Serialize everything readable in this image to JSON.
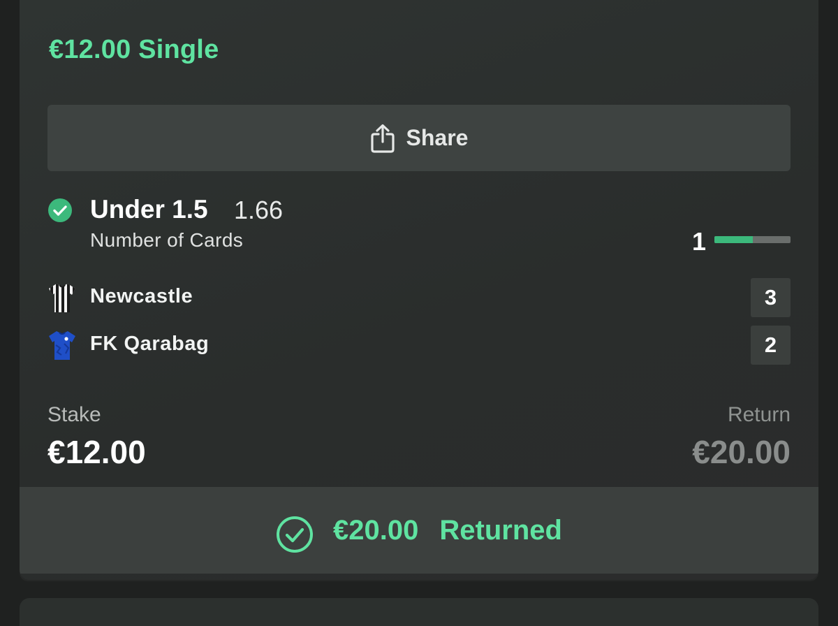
{
  "bet": {
    "title": "€12.00 Single",
    "share_label": "Share",
    "selection": {
      "name": "Under 1.5",
      "odds": "1.66",
      "market": "Number of Cards",
      "status_icon": "check-circle-icon",
      "progress_value": "1",
      "progress_fraction": 0.5
    },
    "teams": [
      {
        "name": "Newcastle",
        "score": "3",
        "shirt_icon": "newcastle-shirt-icon"
      },
      {
        "name": "FK Qarabag",
        "score": "2",
        "shirt_icon": "qarabag-shirt-icon"
      }
    ],
    "stake_label": "Stake",
    "stake_value": "€12.00",
    "return_label": "Return",
    "return_value": "€20.00",
    "returned_amount": "€20.00",
    "returned_label": "Returned"
  },
  "colors": {
    "accent": "#5fe3a1",
    "win_check": "#3cb97c",
    "card_bg": "#2d312f",
    "button_bg": "#3e4341"
  }
}
